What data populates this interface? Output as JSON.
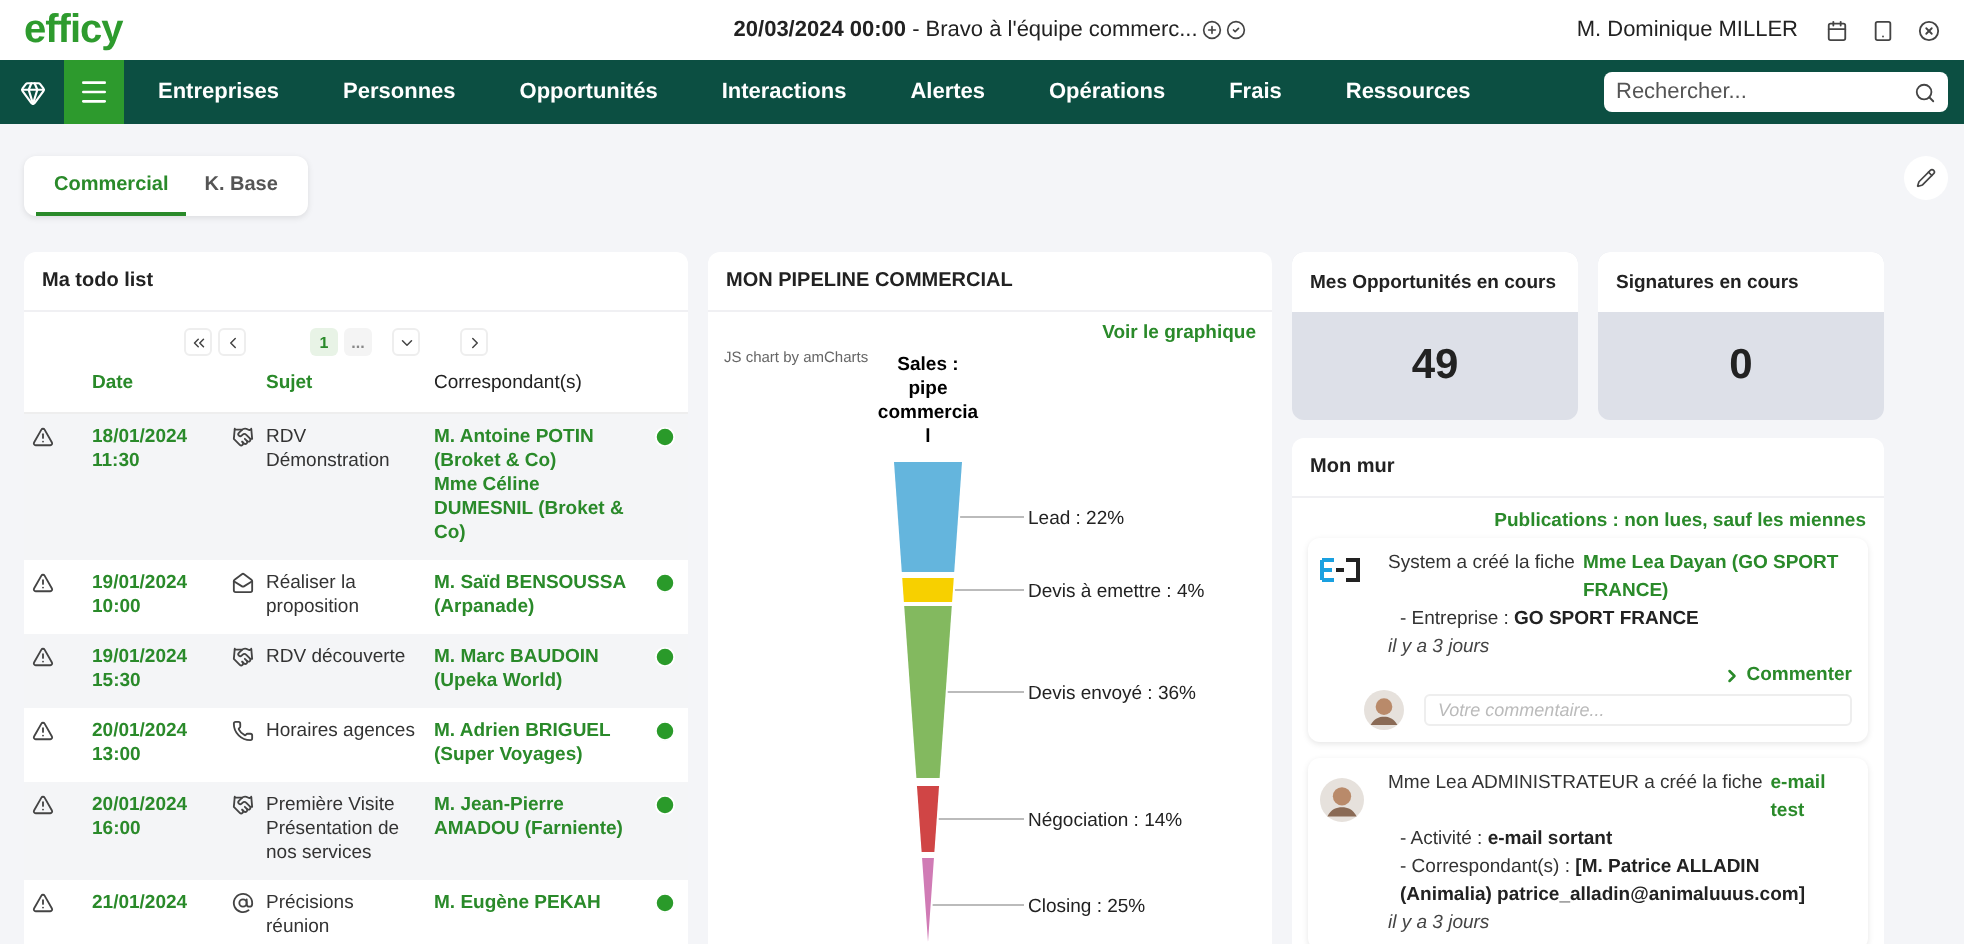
{
  "header": {
    "logo": "efficy",
    "announcement_date": "20/03/2024 00:00",
    "announcement_text": " - Bravo à l'équipe commerc...",
    "user": "M. Dominique MILLER"
  },
  "nav": {
    "items": [
      "Entreprises",
      "Personnes",
      "Opportunités",
      "Interactions",
      "Alertes",
      "Opérations",
      "Frais",
      "Ressources"
    ],
    "search": {
      "placeholder": "Rechercher..."
    }
  },
  "tabs": [
    {
      "label": "Commercial",
      "selected": true
    },
    {
      "label": "K. Base",
      "selected": false
    }
  ],
  "todo": {
    "title": "Ma todo list",
    "pager": {
      "current": "1",
      "more": "..."
    },
    "columns": [
      "Date",
      "Sujet",
      "Correspondant(s)"
    ],
    "rows": [
      {
        "date": "18/01/2024 11:30",
        "kind": "meeting",
        "subject": "RDV Démonstration",
        "contacts": [
          "M. Antoine POTIN (Broket & Co)",
          "Mme Céline DUMESNIL (Broket & Co)"
        ]
      },
      {
        "date": "19/01/2024 10:00",
        "kind": "task",
        "subject": "Réaliser la proposition",
        "contacts": [
          "M. Saïd BENSOUSSA (Arpanade)"
        ]
      },
      {
        "date": "19/01/2024 15:30",
        "kind": "meeting",
        "subject": "RDV découverte",
        "contacts": [
          "M. Marc BAUDOIN (Upeka World)"
        ]
      },
      {
        "date": "20/01/2024 13:00",
        "kind": "call",
        "subject": "Horaires agences",
        "contacts": [
          "M. Adrien BRIGUEL (Super Voyages)"
        ]
      },
      {
        "date": "20/01/2024 16:00",
        "kind": "meeting",
        "subject": "Première Visite Présentation de nos services",
        "contacts": [
          "M. Jean-Pierre AMADOU (Farniente)"
        ]
      },
      {
        "date": "21/01/2024",
        "kind": "email",
        "subject": "Précisions réunion",
        "contacts": [
          "M. Eugène PEKAH"
        ]
      }
    ]
  },
  "pipeline": {
    "title": "MON PIPELINE COMMERCIAL",
    "link": "Voir le graphique",
    "credit": "JS chart by amCharts",
    "chart_title": "Sales : pipe commercia l",
    "segments": [
      {
        "label": "Lead : 22%",
        "color": "#64b5dd"
      },
      {
        "label": "Devis à emettre : 4%",
        "color": "#f7d000"
      },
      {
        "label": "Devis envoyé : 36%",
        "color": "#83b95f"
      },
      {
        "label": "Négociation : 14%",
        "color": "#d04545"
      },
      {
        "label": "Closing : 25%",
        "color": "#d07bb5"
      }
    ]
  },
  "kpis": [
    {
      "title": "Mes Opportunités en cours",
      "value": "49"
    },
    {
      "title": "Signatures en cours",
      "value": "0"
    }
  ],
  "wall": {
    "title": "Mon mur",
    "filter": "Publications : non lues, sauf les miennes",
    "posts": [
      {
        "kind": "logo",
        "author": "System a créé la fiche",
        "link": "Mme Lea Dayan (GO SPORT FRANCE)",
        "details": [
          {
            "label": "- Entreprise : ",
            "value": "GO SPORT FRANCE"
          }
        ],
        "time": "il y a 3 jours",
        "comment_link": "Commenter",
        "comment_placeholder": "Votre commentaire..."
      },
      {
        "kind": "person",
        "author": "Mme Lea ADMINISTRATEUR a créé la fiche",
        "link": "e-mail test",
        "details": [
          {
            "label": "- Activité : ",
            "value": "e-mail sortant"
          },
          {
            "label": "- Correspondant(s) : ",
            "value": "[M. Patrice ALLADIN (Animalia) patrice_alladin@animaluuus.com]"
          }
        ],
        "time": "il y a 3 jours"
      }
    ]
  }
}
